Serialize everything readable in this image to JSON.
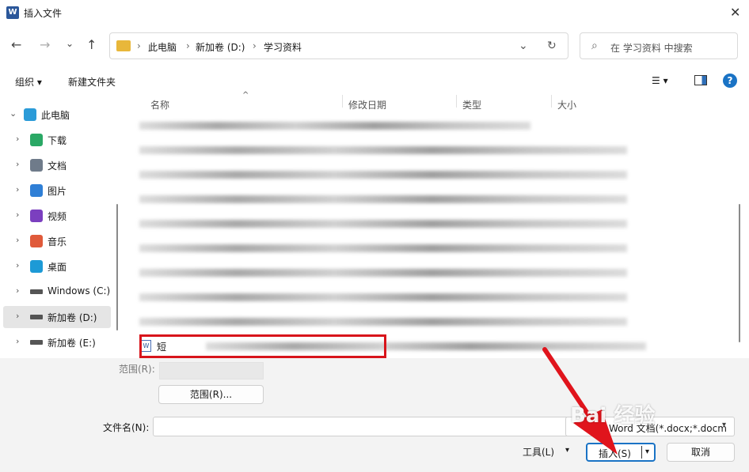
{
  "window": {
    "title": "插入文件",
    "app_icon": "W",
    "close_glyph": "✕"
  },
  "nav": {
    "back": "←",
    "forward": "→",
    "recent": "⌄",
    "up": "↑"
  },
  "address": {
    "crumbs": [
      "此电脑",
      "新加卷 (D:)",
      "学习资料"
    ],
    "sep": "›",
    "dropdown": "⌄",
    "refresh": "↻"
  },
  "search": {
    "placeholder": "在 学习资料 中搜索",
    "icon": "⌕"
  },
  "toolbar": {
    "organize": "组织 ▾",
    "new_folder": "新建文件夹",
    "view": "☰ ▾",
    "help": "?"
  },
  "sidebar": {
    "items": [
      {
        "label": "此电脑",
        "icon": "pc-icon",
        "color": "#2b9bd8",
        "chev": "⌄"
      },
      {
        "label": "下载",
        "icon": "download-icon",
        "color": "#2aa865",
        "chev": "›"
      },
      {
        "label": "文档",
        "icon": "document-icon",
        "color": "#6f7b8a",
        "chev": "›"
      },
      {
        "label": "图片",
        "icon": "picture-icon",
        "color": "#2f7fd6",
        "chev": "›"
      },
      {
        "label": "视频",
        "icon": "video-icon",
        "color": "#7b3fbf",
        "chev": "›"
      },
      {
        "label": "音乐",
        "icon": "music-icon",
        "color": "#e05a3a",
        "chev": "›"
      },
      {
        "label": "桌面",
        "icon": "desktop-icon",
        "color": "#1d9ad6",
        "chev": "›"
      },
      {
        "label": "Windows (C:)",
        "icon": "drive-c-icon",
        "color": "#555555",
        "chev": "›"
      },
      {
        "label": "新加卷 (D:)",
        "icon": "drive-d-icon",
        "color": "#555555",
        "chev": "›"
      },
      {
        "label": "新加卷 (E:)",
        "icon": "drive-e-icon",
        "color": "#555555",
        "chev": "›"
      }
    ]
  },
  "columns": {
    "name": "名称",
    "modified": "修改日期",
    "type": "类型",
    "size": "大小",
    "sort": "^"
  },
  "files": {
    "highlighted": "短视频运营"
  },
  "range": {
    "label": "范围(R):",
    "button": "范围(R)..."
  },
  "footer": {
    "filename_label": "文件名(N):",
    "filename_value": "",
    "filetype": "Word 文档(*.docx;*.docm",
    "tools": "工具(L)",
    "drop": "▾",
    "insert": "插入(S)",
    "cancel": "取消"
  },
  "watermark": "Bai 经验",
  "colors": {
    "highlight_box": "#d8141b",
    "arrow": "#e0141c",
    "primary": "#1a73c5"
  }
}
